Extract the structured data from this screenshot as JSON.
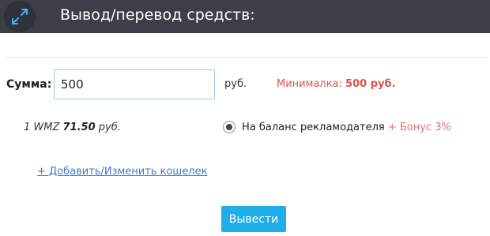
{
  "header": {
    "icon": "arrows-diagonal-icon",
    "title": "Вывод/перевод средств:"
  },
  "form": {
    "amount_label": "Сумма:",
    "amount_value": "500",
    "currency": "руб.",
    "minimum_prefix": "Минималка:",
    "minimum_value": "500 руб.",
    "rate_prefix": "1 WMZ",
    "rate_value": "71.50",
    "rate_unit": "руб.",
    "payout_option": {
      "label": "На баланс рекламодателя",
      "bonus": "+ Бонус 3%",
      "selected": true
    },
    "wallet_link": "+ Добавить/Изменить кошелек",
    "submit_label": "Вывести"
  },
  "colors": {
    "header_bg": "#3c3f47",
    "accent": "#1faee9",
    "link": "#3a7bd5",
    "warning": "#d9534f",
    "bonus": "#e8706a"
  }
}
